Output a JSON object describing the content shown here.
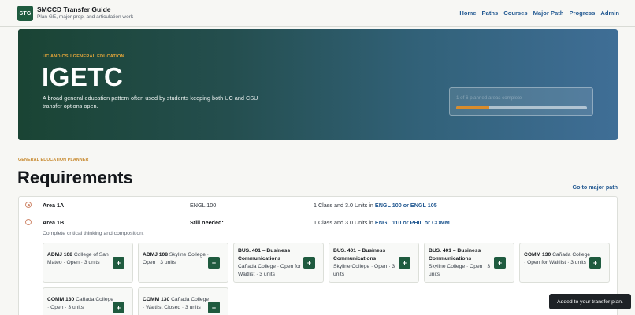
{
  "brand": {
    "logo": "STG",
    "title": "SMCCD Transfer Guide",
    "subtitle": "Plan GE, major prep, and articulation work"
  },
  "nav": [
    "Home",
    "Paths",
    "Courses",
    "Major Path",
    "Progress",
    "Admin"
  ],
  "hero": {
    "kicker": "UC AND CSU GENERAL EDUCATION",
    "title": "IGETC",
    "description": "A broad general education pattern often used by students keeping both UC and CSU transfer options open.",
    "progress_label": "1 of 6 planned areas complete",
    "progress_fraction": 0.25,
    "accent_color": "#d98c2b"
  },
  "section": {
    "kicker": "GENERAL EDUCATION PLANNER",
    "title": "Requirements",
    "major_link": "Go to major path"
  },
  "requirements": [
    {
      "area": "Area 1A",
      "course": "ENGL 100",
      "units_text": "1 Class and 3.0 Units in",
      "units_courses": "ENGL 100 or ENGL 105"
    },
    {
      "area": "Area 1B",
      "course": "Still needed:",
      "units_text": "1 Class and 3.0 Units in",
      "units_courses": "ENGL 110 or PHIL or COMM",
      "note": "Complete critical thinking and composition."
    }
  ],
  "options": [
    {
      "code": "ADMJ 108",
      "detail": "College of San Mateo · Open · 3 units"
    },
    {
      "code": "ADMJ 108",
      "detail": "Skyline College · Open · 3 units"
    },
    {
      "code": "BUS. 401 – Business Communications",
      "detail": "Cañada College · Open for Waitlist · 3 units"
    },
    {
      "code": "BUS. 401 – Business Communications",
      "detail": "Skyline College · Open · 3 units"
    },
    {
      "code": "BUS. 401 – Business Communications",
      "detail": "Skyline College · Open · 3 units"
    },
    {
      "code": "COMM 130",
      "detail": "Cañada College · Open for Waitlist · 3 units"
    },
    {
      "code": "COMM 130",
      "detail": "Cañada College · Open · 3 units"
    },
    {
      "code": "COMM 130",
      "detail": "Cañada College · Waitlist Closed · 3 units"
    }
  ],
  "add_label": "+",
  "toast": "Added to your transfer plan."
}
